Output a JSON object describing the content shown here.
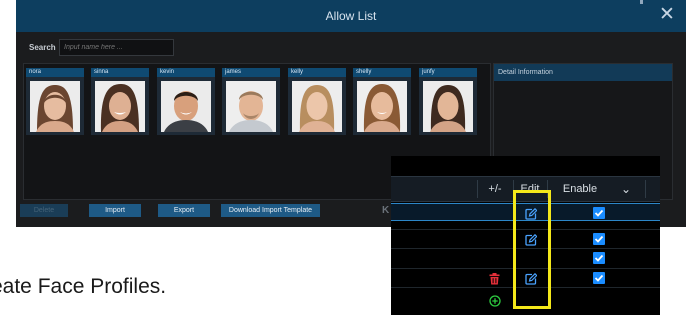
{
  "window": {
    "title": "Allow List",
    "close_glyph": "✕"
  },
  "search": {
    "label": "Search",
    "placeholder": "Input name here ..."
  },
  "profiles": [
    {
      "name": "nora"
    },
    {
      "name": "sinna"
    },
    {
      "name": "kevin"
    },
    {
      "name": "james"
    },
    {
      "name": "kelly"
    },
    {
      "name": "shelly"
    },
    {
      "name": "junfy"
    }
  ],
  "detail": {
    "header": "Detail Information"
  },
  "toolbar": {
    "delete_label": "Delete",
    "import_label": "Import",
    "export_label": "Export",
    "download_template_label": "Download Import Template",
    "pager_first_glyph": "K"
  },
  "table": {
    "columns": [
      "+/-",
      "Edit",
      "Enable"
    ],
    "enable_dropdown_glyph": "⌄",
    "rows": [
      {
        "delete_icon": false,
        "edit_icon": true,
        "enabled": true,
        "selected": true
      },
      {
        "delete_icon": false,
        "edit_icon": true,
        "enabled": true,
        "selected": false
      },
      {
        "delete_icon": false,
        "edit_icon": false,
        "enabled": true,
        "selected": false
      },
      {
        "delete_icon": true,
        "edit_icon": true,
        "enabled": true,
        "selected": false
      }
    ],
    "add_icon": "plus-circle-icon"
  },
  "caption": {
    "text": "reate Face Profiles."
  },
  "colors": {
    "titlebar": "#0d3e5f",
    "accent_blue": "#1a8cff",
    "highlight_box": "#f4e81a",
    "delete_red": "#e8303a",
    "add_green": "#2ecc40"
  }
}
